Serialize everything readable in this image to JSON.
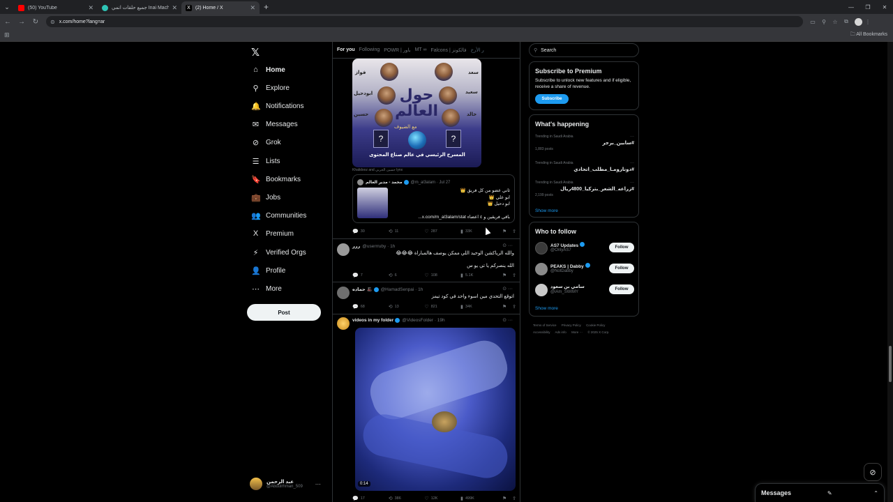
{
  "browser": {
    "tabs": [
      {
        "label": "(50) YouTube",
        "color": "#ff0000"
      },
      {
        "label": "جميع حلقات انمي Inai Machi ...",
        "color": "#2ec4b6"
      },
      {
        "label": "(2) Home / X",
        "color": "#000000"
      }
    ],
    "url": "x.com/home?lang=ar",
    "all_bookmarks": "All Bookmarks"
  },
  "nav": {
    "items": [
      {
        "label": "Home",
        "icon": "⌂"
      },
      {
        "label": "Explore",
        "icon": "⚲"
      },
      {
        "label": "Notifications",
        "icon": "🔔"
      },
      {
        "label": "Messages",
        "icon": "✉"
      },
      {
        "label": "Grok",
        "icon": "⊘"
      },
      {
        "label": "Lists",
        "icon": "☰"
      },
      {
        "label": "Bookmarks",
        "icon": "🔖"
      },
      {
        "label": "Jobs",
        "icon": "💼"
      },
      {
        "label": "Communities",
        "icon": "👥"
      },
      {
        "label": "Premium",
        "icon": "X"
      },
      {
        "label": "Verified Orgs",
        "icon": "⚡"
      },
      {
        "label": "Profile",
        "icon": "👤"
      },
      {
        "label": "More",
        "icon": "⋯"
      }
    ],
    "post_label": "Post",
    "account": {
      "name": "عبد الرحمن",
      "handle": "@Abdulrhman_509"
    }
  },
  "feed": {
    "tabs": [
      "For you",
      "Following",
      "POWR | باور",
      "MT ∞",
      "Falcons | فالكونز",
      "ر الأرخ"
    ],
    "poster": {
      "title": "حول العالم",
      "tagline": "مع الضيوف",
      "subtitle": "المسرح الرئيسي في عالم صناع المحتوى",
      "names_right": [
        "سعد",
        "سعيد",
        "خالد"
      ],
      "names_left": [
        "فواز",
        "ابودحيل",
        "حسين"
      ]
    },
    "people_line": "Khalidooz and حسين الحربي lynx",
    "quote": {
      "name": "محمد - مدير العالم",
      "handle": "@m_al3alam · Jul 27",
      "lines": [
        "ثاني عضو من كل فريق 👑",
        "ابو علي 👑",
        "ابو دحيل 👑"
      ],
      "link": "باقي فريقين و ٤ اعضاء x.com/m_al3alam/stat..."
    },
    "post1_actions": {
      "replies": "30",
      "reposts": "11",
      "likes": "287",
      "views": "33K"
    },
    "post2": {
      "name": "ررر",
      "handle": "@userrruby · 1h",
      "text": "والله الرياكشن الوحيد اللي ممكن يوصف هالمباراة 😂😂😂",
      "text2": "الله ينصركم يا تي يو س",
      "actions": {
        "replies": "7",
        "reposts": "6",
        "likes": "108",
        "views": "5.1K"
      }
    },
    "post3": {
      "name": "حماده 🎩",
      "handle": "@HamadSenpai · 1h",
      "text": "اتوقع التحدي مين اسوء واحد في كود تيمز",
      "actions": {
        "replies": "68",
        "reposts": "13",
        "likes": "821",
        "views": "34K"
      }
    },
    "post4": {
      "name": "videos in my folder",
      "handle": "@VideosFolder · 19h",
      "duration": "0:14",
      "actions": {
        "replies": "17",
        "reposts": "386",
        "likes": "12K",
        "views": "499K"
      }
    }
  },
  "right": {
    "search_placeholder": "Search",
    "premium": {
      "title": "Subscribe to Premium",
      "text": "Subscribe to unlock new features and if eligible, receive a share of revenue.",
      "button": "Subscribe"
    },
    "happening": {
      "title": "What's happening",
      "trends": [
        {
          "context": "Trending in Saudi Arabia",
          "name": "#سابين_برجر",
          "count": "1,883 posts"
        },
        {
          "context": "Trending in Saudi Arabia",
          "name": "#دونارومـا_مطلب_اتحادي",
          "count": ""
        },
        {
          "context": "Trending in Saudi Arabia",
          "name": "#زراعه_الشعر_بتركيا_4800ريال",
          "count": "2,199 posts"
        }
      ],
      "show_more": "Show more"
    },
    "who": {
      "title": "Who to follow",
      "people": [
        {
          "name": "AS7 Updates",
          "handle": "@OnlyAS7",
          "color": "#3a3a3a"
        },
        {
          "name": "PEAKS | Dabby",
          "handle": "@NotDabby",
          "color": "#8a8a8a"
        },
        {
          "name": "سامي بن سعود",
          "handle": "@iAm_SWIMY",
          "color": "#c9c9c9"
        }
      ],
      "follow_label": "Follow",
      "show_more": "Show more"
    },
    "footer": [
      "Terms of Service",
      "Privacy Policy",
      "Cookie Policy",
      "Accessibility",
      "Ads info",
      "More ···",
      "© 2025 X Corp."
    ]
  },
  "messages_drawer": {
    "title": "Messages"
  }
}
